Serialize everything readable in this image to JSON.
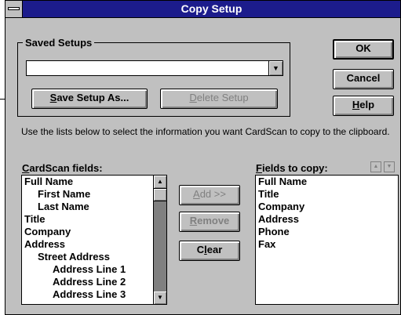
{
  "window": {
    "title": "Copy Setup"
  },
  "saved_setups": {
    "label": "Saved Setups",
    "combo_value": "",
    "save_as_button": {
      "mnemonic": "S",
      "rest": "ave Setup As..."
    },
    "delete_button": {
      "mnemonic": "D",
      "rest": "elete Setup"
    }
  },
  "buttons": {
    "ok": "OK",
    "cancel": "Cancel",
    "help": {
      "mnemonic": "H",
      "rest": "elp"
    }
  },
  "instructions": "Use the lists below to select the information you want CardScan to copy to the clipboard.",
  "cardscan_fields": {
    "label": {
      "mnemonic": "C",
      "rest": "ardScan fields:"
    },
    "items": [
      {
        "text": "Full Name",
        "level": 0
      },
      {
        "text": "First Name",
        "level": 1
      },
      {
        "text": "Last Name",
        "level": 1
      },
      {
        "text": "Title",
        "level": 0
      },
      {
        "text": "Company",
        "level": 0
      },
      {
        "text": "Address",
        "level": 0
      },
      {
        "text": "Street Address",
        "level": 1
      },
      {
        "text": "Address Line 1",
        "level": 2
      },
      {
        "text": "Address Line 2",
        "level": 2
      },
      {
        "text": "Address Line 3",
        "level": 2
      }
    ]
  },
  "transfer_buttons": {
    "add": {
      "mnemonic": "A",
      "rest": "dd >>"
    },
    "remove": {
      "mnemonic": "R",
      "rest": "emove"
    },
    "clear": {
      "before": "C",
      "mnemonic": "l",
      "rest": "ear"
    }
  },
  "fields_to_copy": {
    "label": {
      "mnemonic": "F",
      "rest": "ields to copy:"
    },
    "items": [
      "Full Name",
      "Title",
      "Company",
      "Address",
      "Phone",
      "Fax"
    ]
  },
  "icons": {
    "combo_arrow": "dropdown-arrow-icon",
    "scroll_up": "scroll-up-arrow-icon",
    "scroll_down": "scroll-down-arrow-icon",
    "move_up": "move-up-arrow-icon",
    "move_down": "move-down-arrow-icon"
  },
  "colors": {
    "title_bar": "#1c1c8c",
    "face": "#c0c0c0",
    "disabled_text": "#808080"
  }
}
